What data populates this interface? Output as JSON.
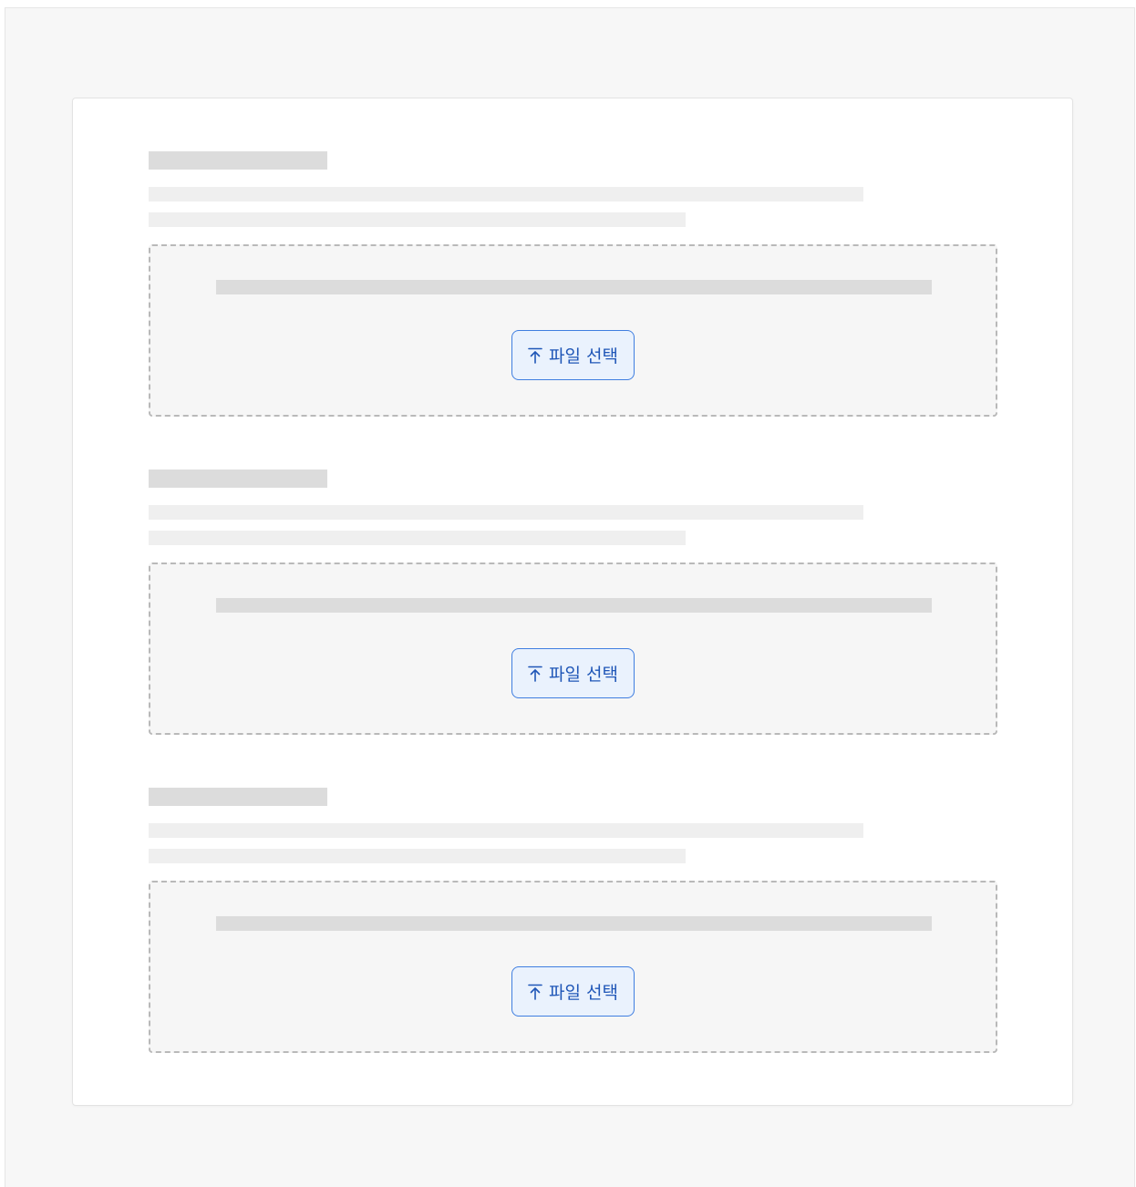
{
  "sections": [
    {
      "upload_button_label": "파일 선택",
      "upload_icon": "upload-icon"
    },
    {
      "upload_button_label": "파일 선택",
      "upload_icon": "upload-icon"
    },
    {
      "upload_button_label": "파일 선택",
      "upload_icon": "upload-icon"
    }
  ],
  "colors": {
    "accent": "#3f7ee0",
    "accent_text": "#1f56b7",
    "button_background": "#eaf2fd",
    "skeleton_dark": "#dcdcdc",
    "skeleton_light": "#efefef",
    "page_background": "#f7f7f7"
  }
}
